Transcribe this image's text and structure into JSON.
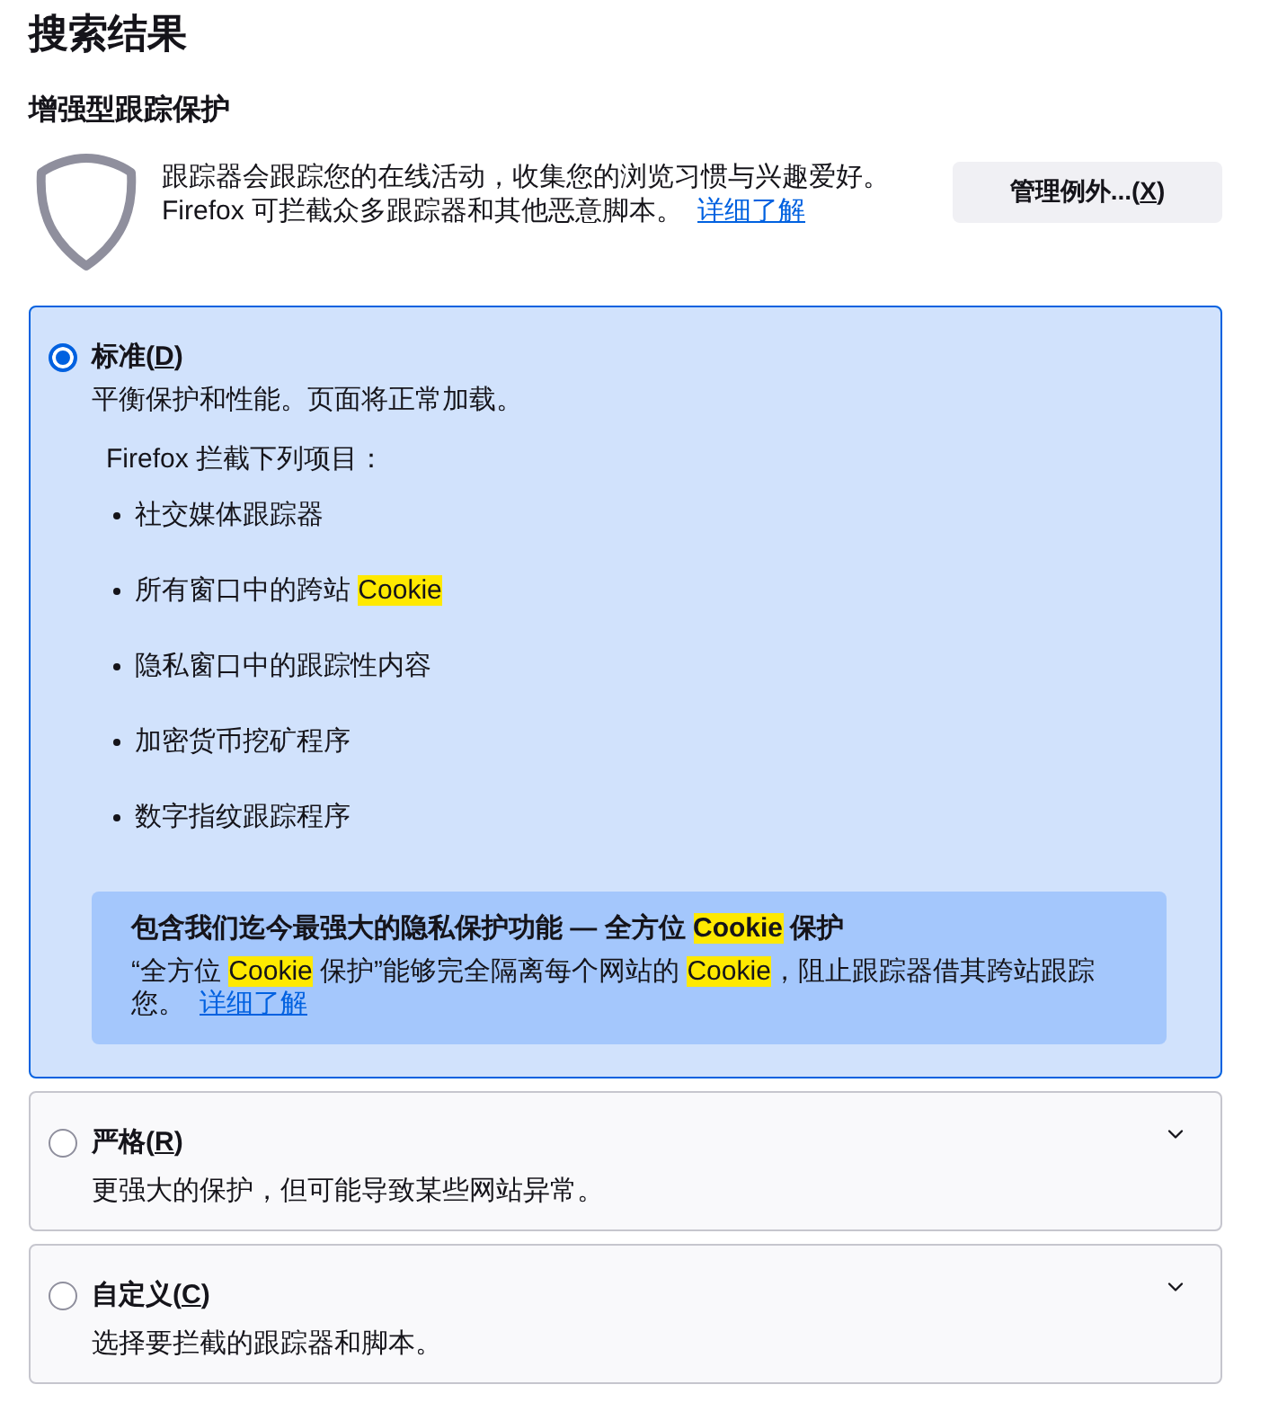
{
  "heading": "搜索结果",
  "section": {
    "title": "增强型跟踪保护",
    "description_lines": [
      "跟踪器会跟踪您的在线活动，收集您的浏览习惯与兴趣爱好。",
      "Firefox 可拦截众多跟踪器和其他恶意脚本。"
    ],
    "link": "详细了解",
    "button": {
      "label_start": "管理例外...(",
      "access_key": "X",
      "label_end": ")"
    }
  },
  "options": [
    {
      "label_start": "标准(",
      "access_key": "D",
      "label_end": ")",
      "selected": true,
      "description": "平衡保护和性能。页面将正常加载。",
      "details": {
        "title": "Firefox 拦截下列项目：",
        "items": [
          {
            "segments": [
              {
                "text": "社交媒体跟踪器",
                "highlighted": false
              }
            ]
          },
          {
            "segments": [
              {
                "text": "所有窗口中的跨站 ",
                "highlighted": false
              },
              {
                "text": "Cookie",
                "highlighted": true
              }
            ]
          },
          {
            "segments": [
              {
                "text": "隐私窗口中的跟踪性内容",
                "highlighted": false
              }
            ]
          },
          {
            "segments": [
              {
                "text": "加密货币挖矿程序",
                "highlighted": false
              }
            ]
          },
          {
            "segments": [
              {
                "text": "数字指纹跟踪程序",
                "highlighted": false
              }
            ]
          }
        ],
        "info": {
          "title": [
            {
              "text": "包含我们迄今最强大的隐私保护功能 — 全方位 ",
              "highlighted": false
            },
            {
              "text": "Cookie",
              "highlighted": true
            },
            {
              "text": " 保护",
              "highlighted": false
            }
          ],
          "body": [
            {
              "text": "“全方位 ",
              "highlighted": false
            },
            {
              "text": "Cookie",
              "highlighted": true
            },
            {
              "text": " 保护”能够完全隔离每个网站的 ",
              "highlighted": false
            },
            {
              "text": "Cookie",
              "highlighted": true
            },
            {
              "text": "，阻止跟踪器借其跨站跟踪您。",
              "highlighted": false
            }
          ],
          "link": "详细了解"
        }
      }
    },
    {
      "label_start": "严格(",
      "access_key": "R",
      "label_end": ")",
      "selected": false,
      "description": "更强大的保护，但可能导致某些网站异常。"
    },
    {
      "label_start": "自定义(",
      "access_key": "C",
      "label_end": ")",
      "selected": false,
      "description": "选择要拦截的跟踪器和脚本。"
    }
  ]
}
